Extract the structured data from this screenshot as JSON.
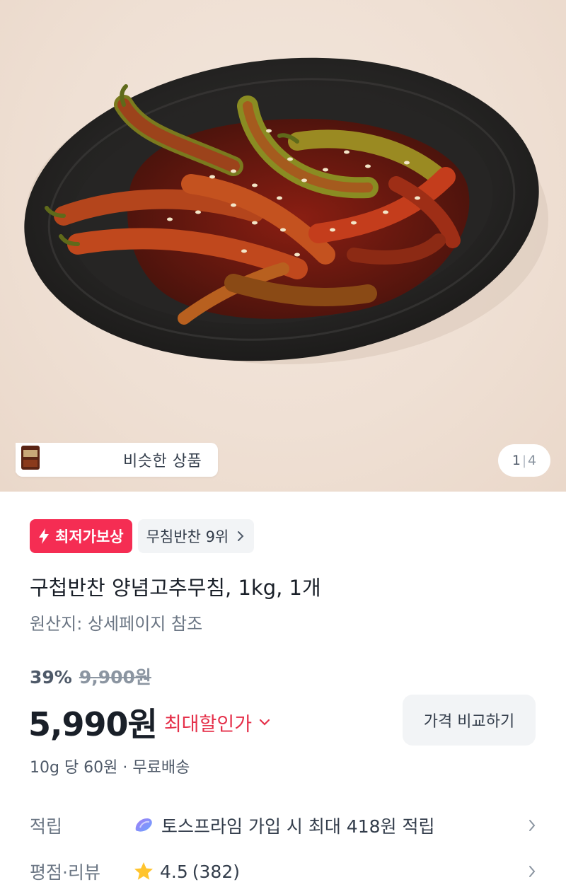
{
  "gallery": {
    "similar_label": "비슷한 상품",
    "counter_current": "1",
    "counter_separator": "|",
    "counter_total": "4"
  },
  "badges": {
    "lowest_price": "최저가보상",
    "rank": "무침반찬 9위"
  },
  "product": {
    "title": "구첩반찬 양념고추무침, 1kg, 1개",
    "origin": "원산지: 상세페이지 참조"
  },
  "pricing": {
    "discount_rate": "39%",
    "original_price": "9,900원",
    "price": "5,990원",
    "max_discount_label": "최대할인가",
    "compare_button": "가격 비교하기",
    "unit_shipping": "10g 당 60원 · 무료배송"
  },
  "points": {
    "label": "적립",
    "value": "토스프라임 가입 시 최대 418원 적립"
  },
  "review": {
    "label": "평점·리뷰",
    "rating": "4.5",
    "count": "(382)"
  },
  "colors": {
    "accent_red": "#f52d53",
    "discount_red": "#e5304a",
    "text_primary": "#191f28",
    "star": "#ffc42e"
  },
  "icons": {
    "lowest_price": "lightning-bolt-icon",
    "rank": "chevron-right-icon",
    "max_discount": "chevron-down-icon",
    "points": "prime-icon",
    "review": "star-icon"
  }
}
